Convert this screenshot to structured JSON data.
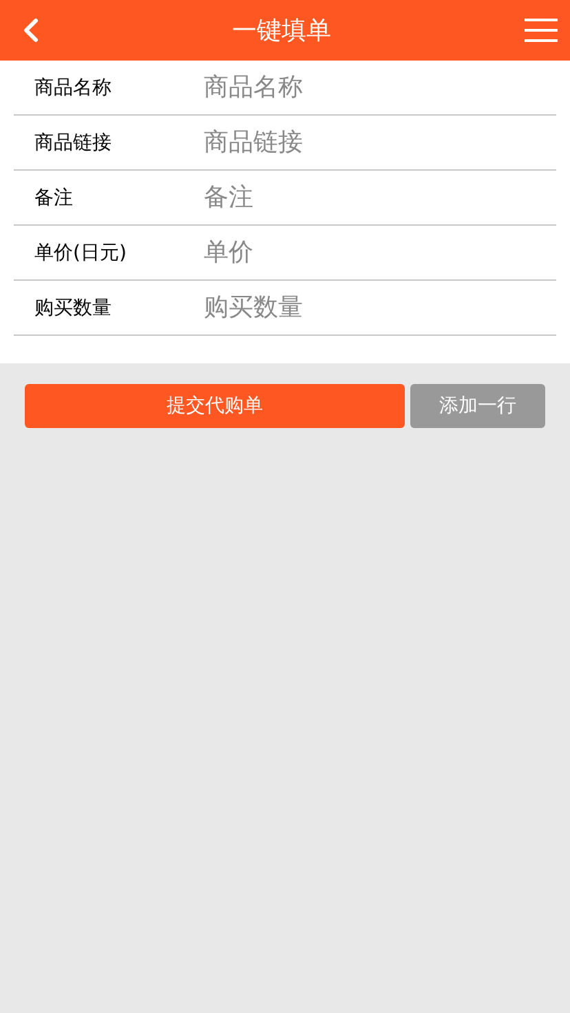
{
  "header": {
    "title": "一键填单"
  },
  "fields": [
    {
      "label": "商品名称",
      "placeholder": "商品名称"
    },
    {
      "label": "商品链接",
      "placeholder": "商品链接"
    },
    {
      "label": "备注",
      "placeholder": "备注"
    },
    {
      "label": "单价(日元)",
      "placeholder": "单价"
    },
    {
      "label": "购买数量",
      "placeholder": "购买数量"
    }
  ],
  "buttons": {
    "submit": "提交代购单",
    "add_row": "添加一行"
  }
}
